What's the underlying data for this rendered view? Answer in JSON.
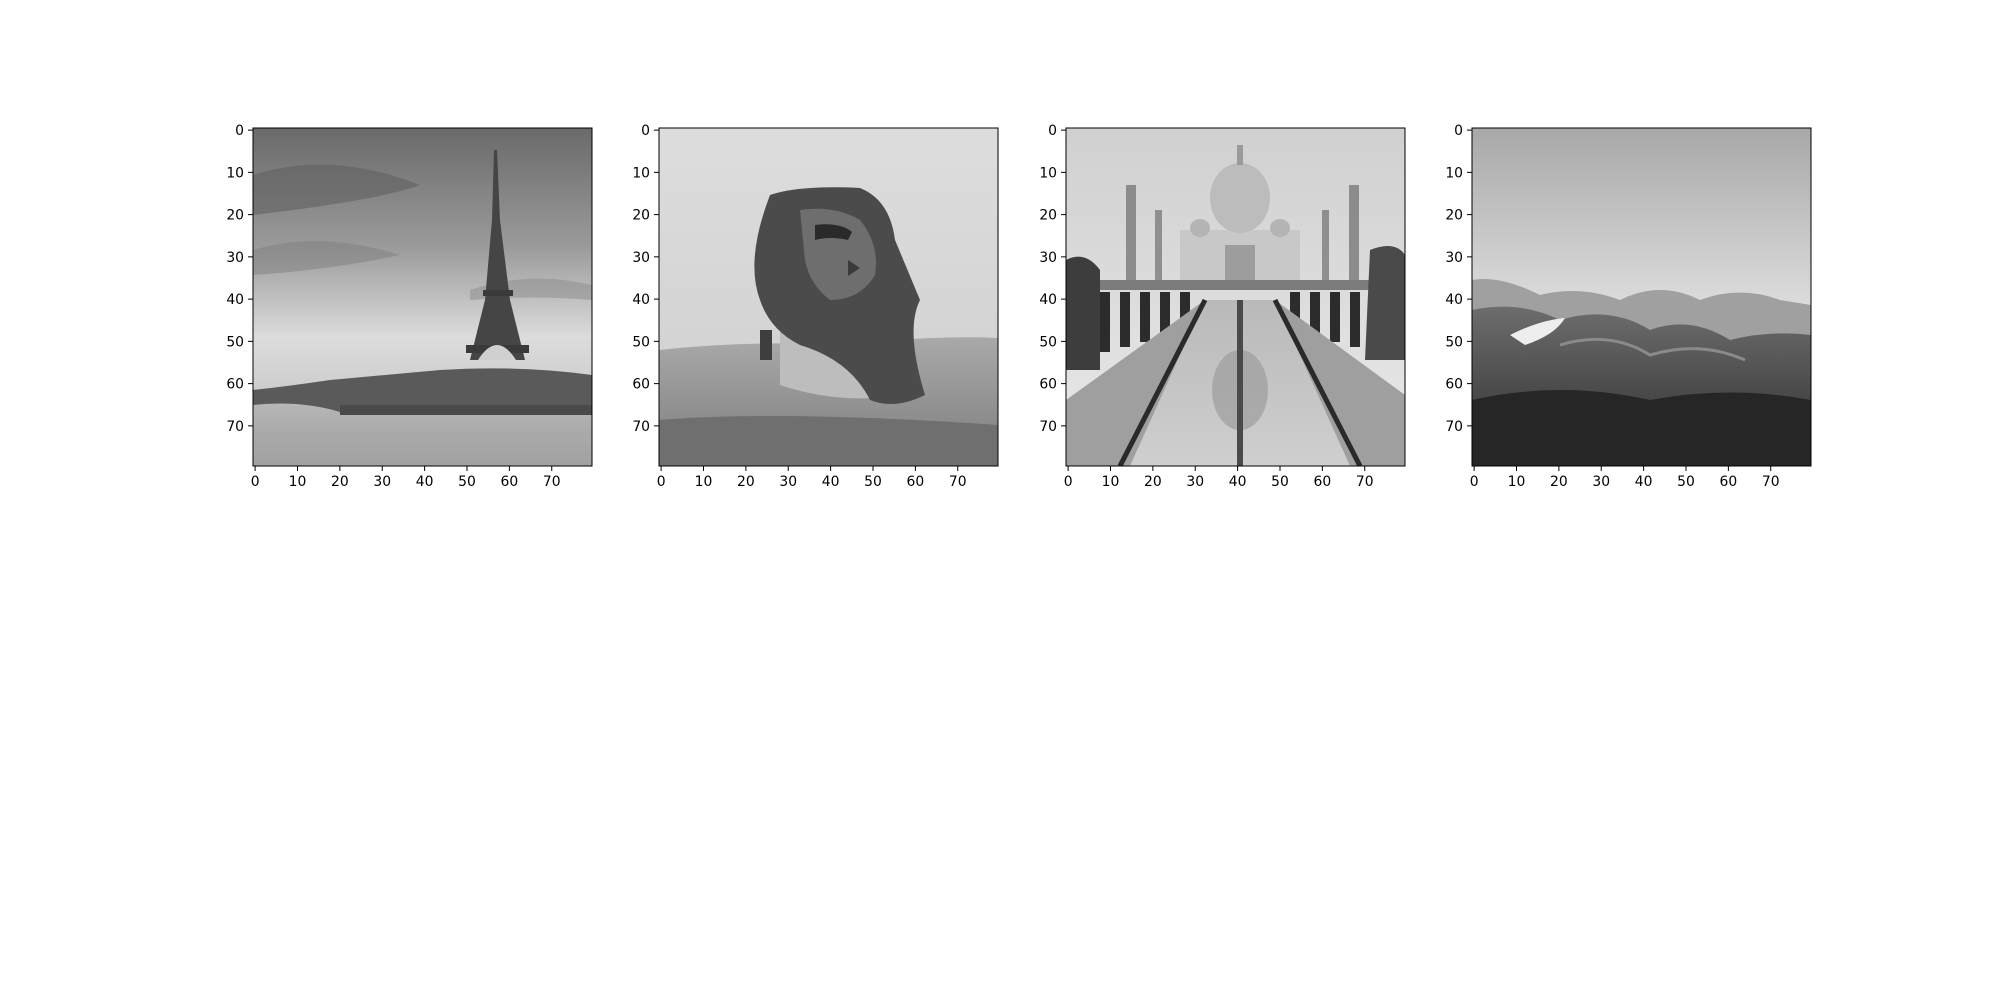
{
  "figure": {
    "background": "#ffffff",
    "colormap": "gray",
    "image_resolution": [
      80,
      80
    ]
  },
  "panels": [
    {
      "subject": "Eiffel Tower by the Seine river",
      "xticks": [
        0,
        10,
        20,
        30,
        40,
        50,
        60,
        70
      ],
      "yticks": [
        0,
        10,
        20,
        30,
        40,
        50,
        60,
        70
      ],
      "xlim": [
        -0.5,
        79.5
      ],
      "ylim": [
        79.5,
        -0.5
      ]
    },
    {
      "subject": "Great Sphinx of Giza",
      "xticks": [
        0,
        10,
        20,
        30,
        40,
        50,
        60,
        70
      ],
      "yticks": [
        0,
        10,
        20,
        30,
        40,
        50,
        60,
        70
      ],
      "xlim": [
        -0.5,
        79.5
      ],
      "ylim": [
        79.5,
        -0.5
      ]
    },
    {
      "subject": "Taj Mahal with reflecting pool",
      "xticks": [
        0,
        10,
        20,
        30,
        40,
        50,
        60,
        70
      ],
      "yticks": [
        0,
        10,
        20,
        30,
        40,
        50,
        60,
        70
      ],
      "xlim": [
        -0.5,
        79.5
      ],
      "ylim": [
        79.5,
        -0.5
      ]
    },
    {
      "subject": "Great Wall of China over mountains",
      "xticks": [
        0,
        10,
        20,
        30,
        40,
        50,
        60,
        70
      ],
      "yticks": [
        0,
        10,
        20,
        30,
        40,
        50,
        60,
        70
      ],
      "xlim": [
        -0.5,
        79.5
      ],
      "ylim": [
        79.5,
        -0.5
      ]
    }
  ]
}
